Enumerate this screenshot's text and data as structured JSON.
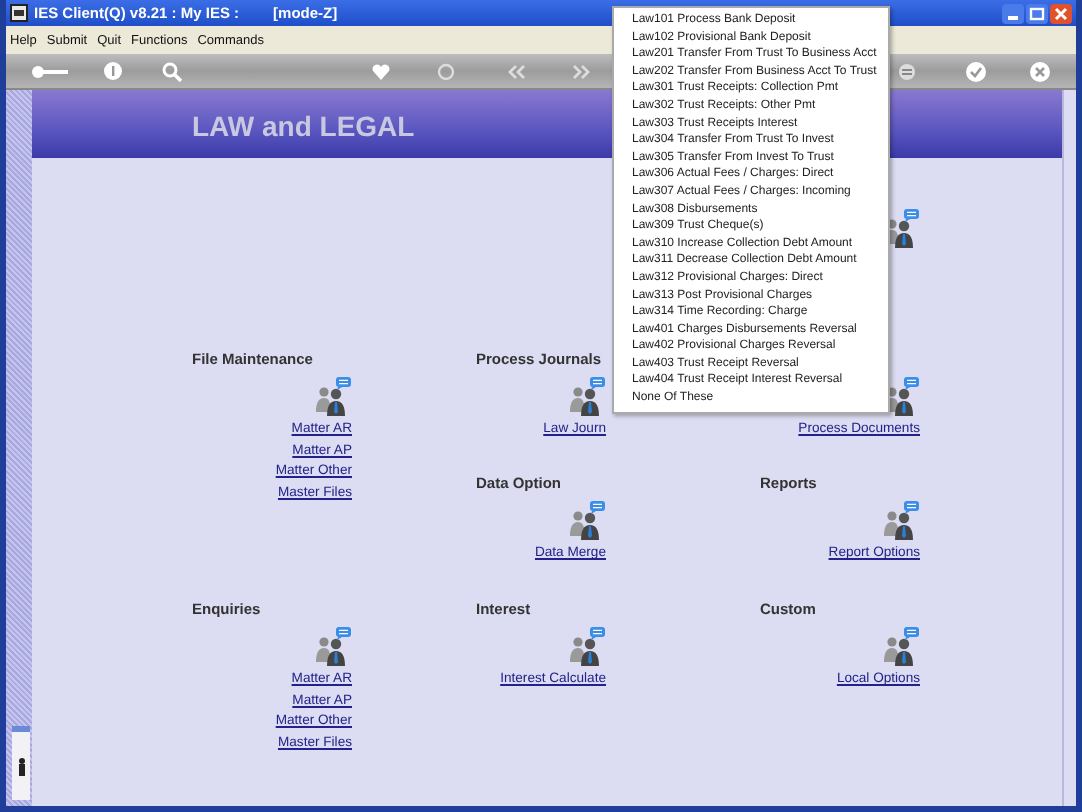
{
  "window": {
    "title": "IES Client(Q) v8.21 : My IES :",
    "mode": "[mode-Z]"
  },
  "menu_bar": [
    "Help",
    "Submit",
    "Quit",
    "Functions",
    "Commands"
  ],
  "page": {
    "title": "LAW and LEGAL"
  },
  "rows": [
    [
      {
        "kind": "empty"
      },
      {
        "kind": "empty"
      },
      {
        "kind": "icon"
      }
    ],
    [
      {
        "kind": "section",
        "title": "File Maintenance",
        "links": [
          "Matter AR",
          "Matter AP",
          "Matter Other",
          "Master Files"
        ]
      },
      {
        "kind": "section",
        "title": "Process Journals",
        "links": [
          "Law Journ"
        ]
      },
      {
        "kind": "section",
        "links": [
          "Process Documents"
        ]
      }
    ],
    [
      {
        "kind": "empty"
      },
      {
        "kind": "section",
        "title": "Data Option",
        "links": [
          "Data Merge"
        ]
      },
      {
        "kind": "section",
        "title": "Reports",
        "links": [
          "Report Options"
        ]
      }
    ],
    [
      {
        "kind": "section",
        "title": "Enquiries",
        "links": [
          "Matter AR",
          "Matter AP",
          "Matter Other",
          "Master Files"
        ]
      },
      {
        "kind": "section",
        "title": "Interest",
        "links": [
          "Interest Calculate"
        ]
      },
      {
        "kind": "section",
        "title": "Custom",
        "links": [
          "Local Options"
        ]
      }
    ]
  ],
  "popup_menu": {
    "items": [
      "Law101 Process Bank Deposit",
      "Law102 Provisional Bank Deposit",
      "Law201 Transfer From Trust To Business Acct",
      "Law202 Transfer From Business Acct To Trust",
      "Law301 Trust Receipts: Collection Pmt",
      "Law302 Trust Receipts: Other Pmt",
      "Law303 Trust Receipts Interest",
      "Law304 Transfer From Trust To Invest",
      "Law305 Transfer From Invest To Trust",
      "Law306 Actual Fees / Charges: Direct",
      "Law307 Actual Fees / Charges: Incoming",
      "Law308 Disbursements",
      "Law309 Trust Cheque(s)",
      "Law310 Increase Collection Debt Amount",
      "Law311 Decrease Collection Debt Amount",
      "Law312 Provisional Charges: Direct",
      "Law313 Post Provisional Charges",
      "Law314 Time Recording: Charge",
      "Law401 Charges  Disbursements Reversal",
      "Law402 Provisional Charges Reversal",
      "Law403 Trust Receipt Reversal",
      "Law404 Trust Receipt Interest Reversal",
      "None Of These"
    ]
  }
}
